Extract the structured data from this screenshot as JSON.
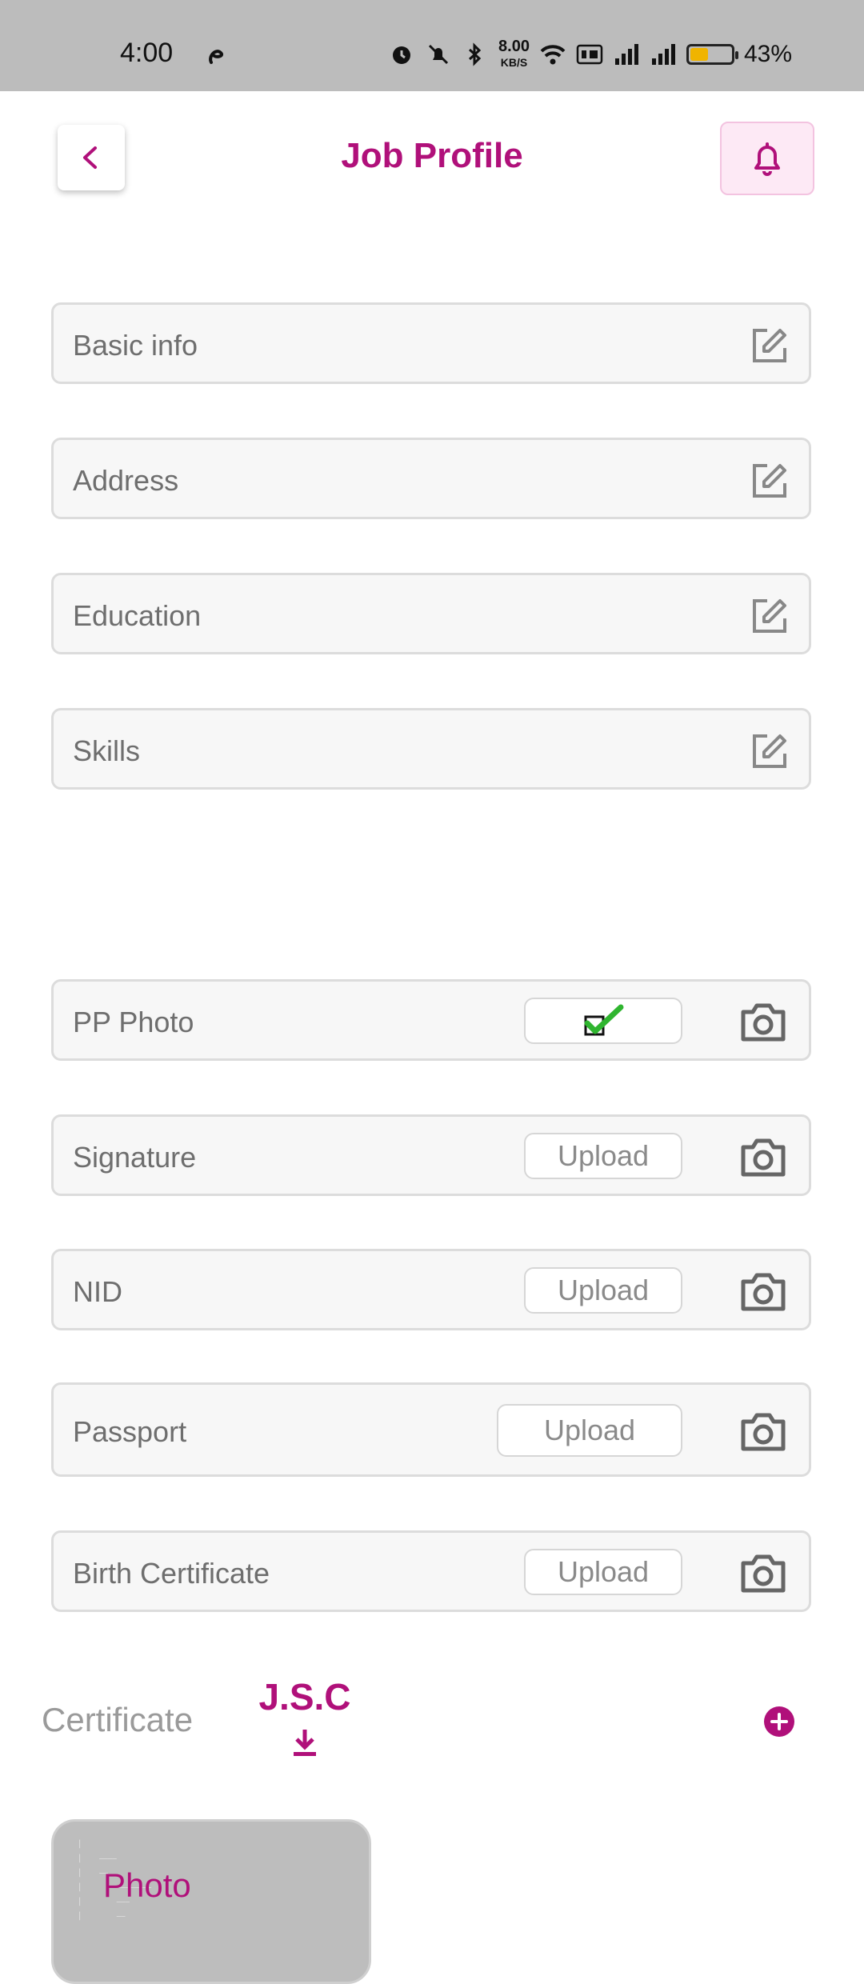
{
  "status_bar": {
    "time": "4:00",
    "rate_value": "8.00",
    "rate_unit": "KB/S",
    "battery": "43%",
    "battery_level": 0.43
  },
  "header": {
    "title": "Job Profile"
  },
  "profile_fields": [
    {
      "label": "Basic info"
    },
    {
      "label": "Address"
    },
    {
      "label": "Education"
    },
    {
      "label": "Skills"
    }
  ],
  "documents": [
    {
      "label": "PP Photo",
      "status": "uploaded"
    },
    {
      "label": "Signature",
      "upload_label": "Upload"
    },
    {
      "label": "NID",
      "upload_label": "Upload"
    },
    {
      "label": "Passport",
      "upload_label": "Upload"
    },
    {
      "label": "Birth Certificate",
      "upload_label": "Upload"
    }
  ],
  "certificate": {
    "label": "Certificate",
    "items": [
      {
        "name": "J.S.C"
      }
    ],
    "photo_label": "Photo"
  },
  "colors": {
    "brand": "#b0107a",
    "status_bar_bg": "#bcbcbc",
    "check": "#2fb52f"
  }
}
